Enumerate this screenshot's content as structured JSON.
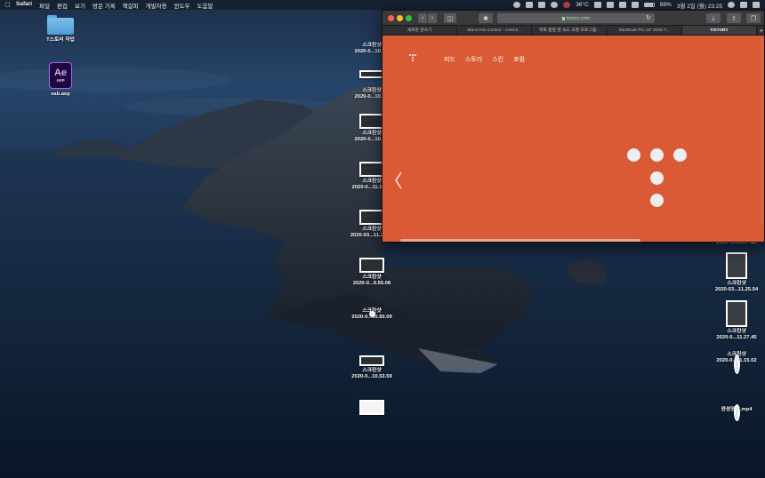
{
  "menubar": {
    "app_name": "Safari",
    "items": [
      "파일",
      "편집",
      "보기",
      "방문 기록",
      "책갈피",
      "개발자용",
      "윈도우",
      "도움말"
    ],
    "temperature": "36°C",
    "battery": "98%",
    "datetime": "3월 2일 (월)  23:25"
  },
  "desktop_left": [
    {
      "label": "T스토리 작업",
      "icon": "folder-icon"
    },
    {
      "label": "sab.aep",
      "icon": "after-effects-icon",
      "ae_letters": "Ae",
      "ae_sub": "AEP"
    }
  ],
  "desktop_middle": [
    {
      "label1": "스크린샷",
      "label2": "2020-0...10.4..."
    },
    {
      "label1": "",
      "label2": ""
    },
    {
      "label1": "스크린샷",
      "label2": "2020-0...10.4..."
    },
    {
      "label1": "스크린샷",
      "label2": "2020-0...10.3..."
    },
    {
      "label1": "스크린샷",
      "label2": "2020-0...11.11.21"
    },
    {
      "label1": "스크린샷",
      "label2": "2020-03...11.23.37"
    },
    {
      "label1": "스크린샷",
      "label2": "2020-0...9.55.08"
    },
    {
      "label1": "스크린샷",
      "label2": "2020-0...10.50.09"
    },
    {
      "label1": "스크린샷",
      "label2": "2020-0...10.53.59"
    }
  ],
  "desktop_right": [
    {
      "label1": "",
      "label2": "2020-0...10.57.18"
    },
    {
      "label1": "스크린샷",
      "label2": "2020-03...11.25.54"
    },
    {
      "label1": "스크린샷",
      "label2": "2020-0...11.27.45"
    },
    {
      "label1": "스크린샷",
      "label2": "2020-0...11.15.02"
    },
    {
      "label1": "완성영상.mp4",
      "label2": ""
    }
  ],
  "safari": {
    "url": "tistory.com",
    "tabs": [
      "새로운 글쓰기",
      "Macs Fan Control - control...",
      "맥북 발열 팬 속도 조절 프로그램...",
      "MacBook Pro 16\" 2019 T...",
      "TISTORY"
    ],
    "active_tab": 4,
    "nav": [
      "피드",
      "스토리",
      "스킨",
      "포럼"
    ],
    "background_color": "#d95a34",
    "prev_icon": "chevron-left-icon"
  }
}
